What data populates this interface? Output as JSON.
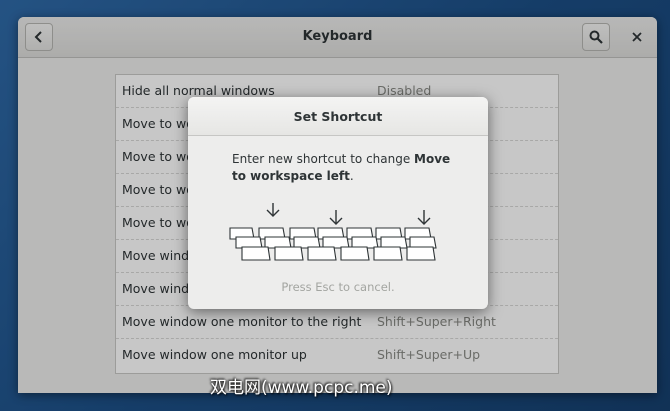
{
  "window": {
    "title": "Keyboard",
    "back_icon": "chevron-left-icon",
    "search_icon": "search-icon",
    "close_icon": "close-icon"
  },
  "shortcuts": [
    {
      "name": "Hide all normal windows",
      "accel": "Disabled"
    },
    {
      "name": "Move to wo",
      "accel": ""
    },
    {
      "name": "Move to wo",
      "accel": ""
    },
    {
      "name": "Move to wo",
      "accel": ""
    },
    {
      "name": "Move to wo",
      "accel": ""
    },
    {
      "name": "Move windo",
      "accel": ""
    },
    {
      "name": "Move windo",
      "accel": ""
    },
    {
      "name": "Move window one monitor to the right",
      "accel": "Shift+Super+Right"
    },
    {
      "name": "Move window one monitor up",
      "accel": "Shift+Super+Up"
    }
  ],
  "dialog": {
    "title": "Set Shortcut",
    "message_prefix": "Enter new shortcut to change ",
    "message_action": "Move to workspace left",
    "message_suffix": ".",
    "hint": "Press Esc to cancel."
  },
  "watermark": "双电网(www.pcpc.me)"
}
